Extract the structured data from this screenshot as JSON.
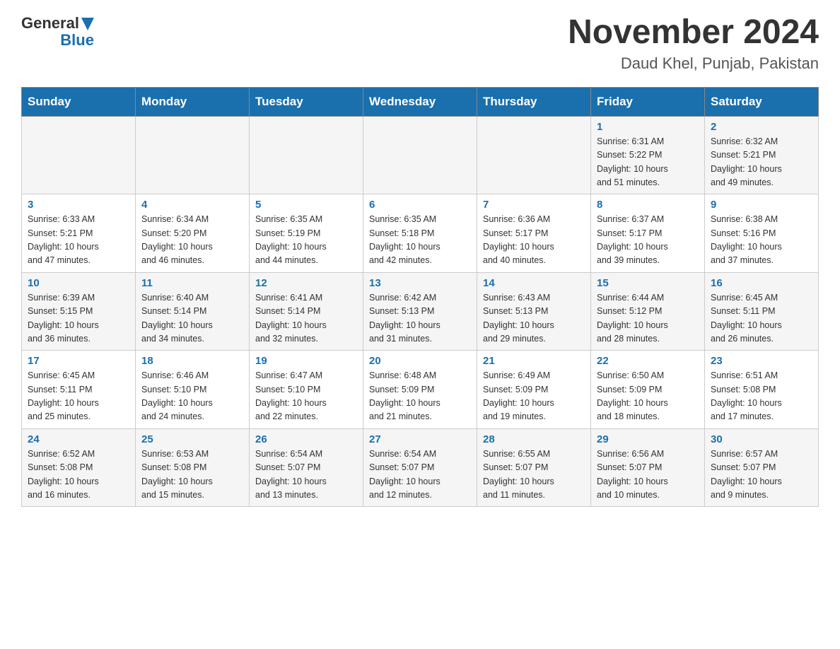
{
  "header": {
    "logo": {
      "general": "General",
      "blue": "Blue"
    },
    "title": "November 2024",
    "location": "Daud Khel, Punjab, Pakistan"
  },
  "calendar": {
    "days": [
      "Sunday",
      "Monday",
      "Tuesday",
      "Wednesday",
      "Thursday",
      "Friday",
      "Saturday"
    ],
    "rows": [
      [
        {
          "day": "",
          "info": ""
        },
        {
          "day": "",
          "info": ""
        },
        {
          "day": "",
          "info": ""
        },
        {
          "day": "",
          "info": ""
        },
        {
          "day": "",
          "info": ""
        },
        {
          "day": "1",
          "info": "Sunrise: 6:31 AM\nSunset: 5:22 PM\nDaylight: 10 hours\nand 51 minutes."
        },
        {
          "day": "2",
          "info": "Sunrise: 6:32 AM\nSunset: 5:21 PM\nDaylight: 10 hours\nand 49 minutes."
        }
      ],
      [
        {
          "day": "3",
          "info": "Sunrise: 6:33 AM\nSunset: 5:21 PM\nDaylight: 10 hours\nand 47 minutes."
        },
        {
          "day": "4",
          "info": "Sunrise: 6:34 AM\nSunset: 5:20 PM\nDaylight: 10 hours\nand 46 minutes."
        },
        {
          "day": "5",
          "info": "Sunrise: 6:35 AM\nSunset: 5:19 PM\nDaylight: 10 hours\nand 44 minutes."
        },
        {
          "day": "6",
          "info": "Sunrise: 6:35 AM\nSunset: 5:18 PM\nDaylight: 10 hours\nand 42 minutes."
        },
        {
          "day": "7",
          "info": "Sunrise: 6:36 AM\nSunset: 5:17 PM\nDaylight: 10 hours\nand 40 minutes."
        },
        {
          "day": "8",
          "info": "Sunrise: 6:37 AM\nSunset: 5:17 PM\nDaylight: 10 hours\nand 39 minutes."
        },
        {
          "day": "9",
          "info": "Sunrise: 6:38 AM\nSunset: 5:16 PM\nDaylight: 10 hours\nand 37 minutes."
        }
      ],
      [
        {
          "day": "10",
          "info": "Sunrise: 6:39 AM\nSunset: 5:15 PM\nDaylight: 10 hours\nand 36 minutes."
        },
        {
          "day": "11",
          "info": "Sunrise: 6:40 AM\nSunset: 5:14 PM\nDaylight: 10 hours\nand 34 minutes."
        },
        {
          "day": "12",
          "info": "Sunrise: 6:41 AM\nSunset: 5:14 PM\nDaylight: 10 hours\nand 32 minutes."
        },
        {
          "day": "13",
          "info": "Sunrise: 6:42 AM\nSunset: 5:13 PM\nDaylight: 10 hours\nand 31 minutes."
        },
        {
          "day": "14",
          "info": "Sunrise: 6:43 AM\nSunset: 5:13 PM\nDaylight: 10 hours\nand 29 minutes."
        },
        {
          "day": "15",
          "info": "Sunrise: 6:44 AM\nSunset: 5:12 PM\nDaylight: 10 hours\nand 28 minutes."
        },
        {
          "day": "16",
          "info": "Sunrise: 6:45 AM\nSunset: 5:11 PM\nDaylight: 10 hours\nand 26 minutes."
        }
      ],
      [
        {
          "day": "17",
          "info": "Sunrise: 6:45 AM\nSunset: 5:11 PM\nDaylight: 10 hours\nand 25 minutes."
        },
        {
          "day": "18",
          "info": "Sunrise: 6:46 AM\nSunset: 5:10 PM\nDaylight: 10 hours\nand 24 minutes."
        },
        {
          "day": "19",
          "info": "Sunrise: 6:47 AM\nSunset: 5:10 PM\nDaylight: 10 hours\nand 22 minutes."
        },
        {
          "day": "20",
          "info": "Sunrise: 6:48 AM\nSunset: 5:09 PM\nDaylight: 10 hours\nand 21 minutes."
        },
        {
          "day": "21",
          "info": "Sunrise: 6:49 AM\nSunset: 5:09 PM\nDaylight: 10 hours\nand 19 minutes."
        },
        {
          "day": "22",
          "info": "Sunrise: 6:50 AM\nSunset: 5:09 PM\nDaylight: 10 hours\nand 18 minutes."
        },
        {
          "day": "23",
          "info": "Sunrise: 6:51 AM\nSunset: 5:08 PM\nDaylight: 10 hours\nand 17 minutes."
        }
      ],
      [
        {
          "day": "24",
          "info": "Sunrise: 6:52 AM\nSunset: 5:08 PM\nDaylight: 10 hours\nand 16 minutes."
        },
        {
          "day": "25",
          "info": "Sunrise: 6:53 AM\nSunset: 5:08 PM\nDaylight: 10 hours\nand 15 minutes."
        },
        {
          "day": "26",
          "info": "Sunrise: 6:54 AM\nSunset: 5:07 PM\nDaylight: 10 hours\nand 13 minutes."
        },
        {
          "day": "27",
          "info": "Sunrise: 6:54 AM\nSunset: 5:07 PM\nDaylight: 10 hours\nand 12 minutes."
        },
        {
          "day": "28",
          "info": "Sunrise: 6:55 AM\nSunset: 5:07 PM\nDaylight: 10 hours\nand 11 minutes."
        },
        {
          "day": "29",
          "info": "Sunrise: 6:56 AM\nSunset: 5:07 PM\nDaylight: 10 hours\nand 10 minutes."
        },
        {
          "day": "30",
          "info": "Sunrise: 6:57 AM\nSunset: 5:07 PM\nDaylight: 10 hours\nand 9 minutes."
        }
      ]
    ]
  }
}
